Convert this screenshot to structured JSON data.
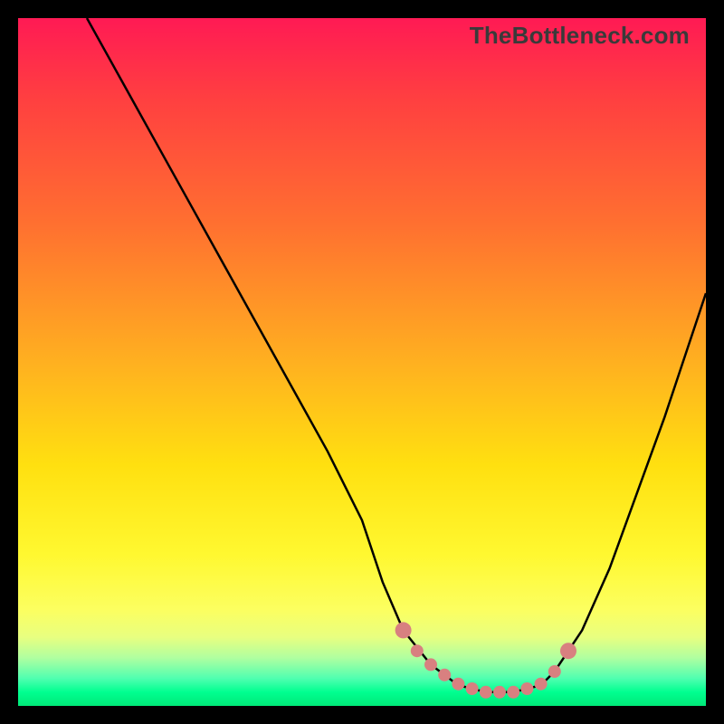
{
  "watermark": "TheBottleneck.com",
  "chart_data": {
    "type": "line",
    "title": "",
    "xlabel": "",
    "ylabel": "",
    "xlim": [
      0,
      100
    ],
    "ylim": [
      0,
      100
    ],
    "grid": false,
    "legend": false,
    "gradient": {
      "top": "#ff1a54",
      "mid": "#ffe010",
      "bottom": "#00e878"
    },
    "series": [
      {
        "name": "bottleneck-curve",
        "color": "#000000",
        "x": [
          10,
          15,
          20,
          25,
          30,
          35,
          40,
          45,
          50,
          53,
          56,
          60,
          64,
          68,
          72,
          76,
          78,
          82,
          86,
          90,
          94,
          98,
          100
        ],
        "y": [
          100,
          91,
          82,
          73,
          64,
          55,
          46,
          37,
          27,
          18,
          11,
          6,
          3,
          2,
          2,
          3,
          5,
          11,
          20,
          31,
          42,
          54,
          60
        ]
      }
    ],
    "highlight": {
      "name": "fit-region-markers",
      "color": "#d88080",
      "x": [
        56,
        58,
        60,
        62,
        64,
        66,
        68,
        70,
        72,
        74,
        76,
        78,
        80
      ],
      "y": [
        11,
        8,
        6,
        4.5,
        3.2,
        2.5,
        2,
        2,
        2,
        2.5,
        3.2,
        5,
        8
      ]
    }
  }
}
